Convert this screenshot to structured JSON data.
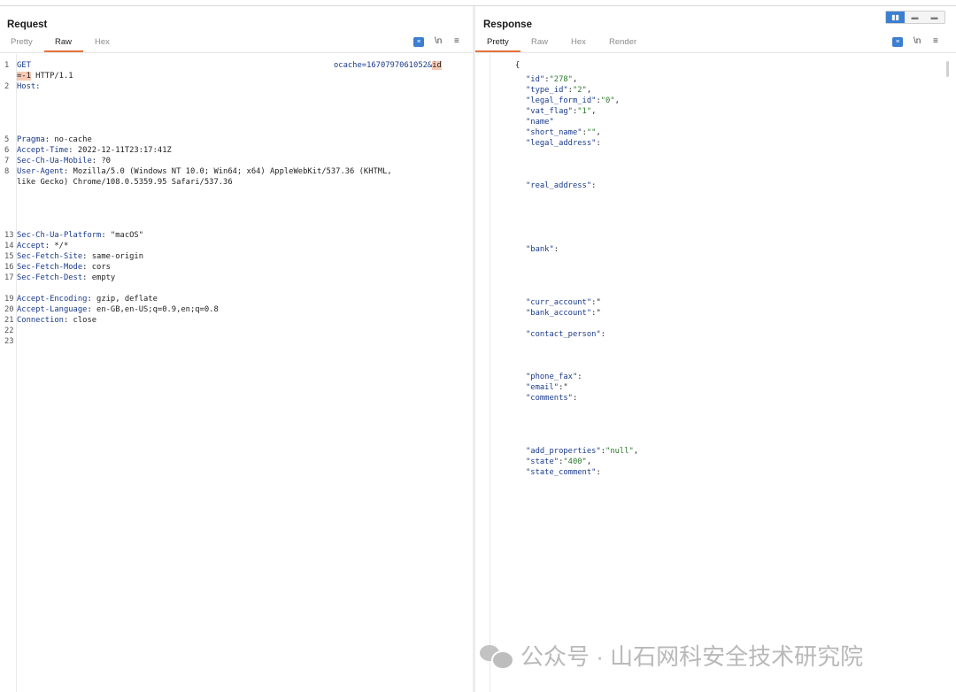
{
  "request": {
    "title": "Request",
    "tabs": [
      "Pretty",
      "Raw",
      "Hex"
    ],
    "active_tab": "Raw",
    "icons": {
      "actions": "list-icon",
      "newline": "\\n",
      "menu": "≡"
    },
    "lines": [
      {
        "n": "1",
        "parts": [
          {
            "t": "GET",
            "c": "hdr"
          }
        ]
      },
      {
        "n": "",
        "parts": [
          {
            "t": "=-1",
            "c": "hl"
          },
          {
            "t": " HTTP/1.1",
            "c": "val"
          }
        ]
      },
      {
        "n": "2",
        "parts": [
          {
            "t": "Host:",
            "c": "hdr"
          }
        ]
      },
      {
        "n": "5",
        "parts": [
          {
            "t": "Pragma",
            "c": "hdr"
          },
          {
            "t": ": no-cache",
            "c": "val"
          }
        ]
      },
      {
        "n": "6",
        "parts": [
          {
            "t": "Accept-Time",
            "c": "hdr"
          },
          {
            "t": ": 2022-12-11T23:17:41Z",
            "c": "val"
          }
        ]
      },
      {
        "n": "7",
        "parts": [
          {
            "t": "Sec-Ch-Ua-Mobile",
            "c": "hdr"
          },
          {
            "t": ": ?0",
            "c": "val"
          }
        ]
      },
      {
        "n": "8",
        "parts": [
          {
            "t": "User-Agent",
            "c": "hdr"
          },
          {
            "t": ": Mozilla/5.0 (Windows NT 10.0; Win64; x64) AppleWebKit/537.36 (KHTML,",
            "c": "val"
          }
        ]
      },
      {
        "n": "",
        "parts": [
          {
            "t": "like Gecko) Chrome/108.0.5359.95 Safari/537.36",
            "c": "val"
          }
        ]
      },
      {
        "n": "13",
        "parts": [
          {
            "t": "Sec-Ch-Ua-Platform",
            "c": "hdr"
          },
          {
            "t": ": \"macOS\"",
            "c": "val"
          }
        ]
      },
      {
        "n": "14",
        "parts": [
          {
            "t": "Accept",
            "c": "hdr"
          },
          {
            "t": ": */*",
            "c": "val"
          }
        ]
      },
      {
        "n": "15",
        "parts": [
          {
            "t": "Sec-Fetch-Site",
            "c": "hdr"
          },
          {
            "t": ": same-origin",
            "c": "val"
          }
        ]
      },
      {
        "n": "16",
        "parts": [
          {
            "t": "Sec-Fetch-Mode",
            "c": "hdr"
          },
          {
            "t": ": cors",
            "c": "val"
          }
        ]
      },
      {
        "n": "17",
        "parts": [
          {
            "t": "Sec-Fetch-Dest",
            "c": "hdr"
          },
          {
            "t": ": empty",
            "c": "val"
          }
        ]
      },
      {
        "n": "19",
        "parts": [
          {
            "t": "Accept-Encoding",
            "c": "hdr"
          },
          {
            "t": ": gzip, deflate",
            "c": "val"
          }
        ]
      },
      {
        "n": "20",
        "parts": [
          {
            "t": "Accept-Language",
            "c": "hdr"
          },
          {
            "t": ": en-GB,en-US;q=0.9,en;q=0.8",
            "c": "val"
          }
        ]
      },
      {
        "n": "21",
        "parts": [
          {
            "t": "Connection",
            "c": "hdr"
          },
          {
            "t": ": close",
            "c": "val"
          }
        ]
      },
      {
        "n": "22",
        "parts": []
      },
      {
        "n": "23",
        "parts": []
      }
    ],
    "url_fragment": [
      {
        "t": "ocache=1670797061052&",
        "c": "hdr"
      },
      {
        "t": "id",
        "c": "hl"
      }
    ]
  },
  "response": {
    "title": "Response",
    "tabs": [
      "Pretty",
      "Raw",
      "Hex",
      "Render"
    ],
    "active_tab": "Pretty",
    "icons": {
      "actions": "list-icon",
      "newline": "\\n",
      "menu": "≡"
    },
    "view_toggle": [
      "▮▮",
      "▬",
      "▬"
    ],
    "lines": [
      {
        "parts": [
          {
            "t": "{",
            "c": "val"
          }
        ]
      },
      {
        "parts": [
          {
            "t": "\"id\"",
            "c": "key"
          },
          {
            "t": ":",
            "c": "val"
          },
          {
            "t": "\"278\"",
            "c": "str"
          },
          {
            "t": ",",
            "c": "val"
          }
        ]
      },
      {
        "parts": [
          {
            "t": "\"type_id\"",
            "c": "key"
          },
          {
            "t": ":",
            "c": "val"
          },
          {
            "t": "\"2\"",
            "c": "str"
          },
          {
            "t": ",",
            "c": "val"
          }
        ]
      },
      {
        "parts": [
          {
            "t": "\"legal_form_id\"",
            "c": "key"
          },
          {
            "t": ":",
            "c": "val"
          },
          {
            "t": "\"0\"",
            "c": "str"
          },
          {
            "t": ",",
            "c": "val"
          }
        ]
      },
      {
        "parts": [
          {
            "t": "\"vat_flag\"",
            "c": "key"
          },
          {
            "t": ":",
            "c": "val"
          },
          {
            "t": "\"1\"",
            "c": "str"
          },
          {
            "t": ",",
            "c": "val"
          }
        ]
      },
      {
        "parts": [
          {
            "t": "\"name\"",
            "c": "key"
          }
        ]
      },
      {
        "parts": [
          {
            "t": "\"short_name\"",
            "c": "key"
          },
          {
            "t": ":",
            "c": "val"
          },
          {
            "t": "\"\"",
            "c": "str"
          },
          {
            "t": ",",
            "c": "val"
          }
        ]
      },
      {
        "parts": [
          {
            "t": "\"legal_address\"",
            "c": "key"
          },
          {
            "t": ":",
            "c": "val"
          }
        ]
      },
      {
        "parts": [
          {
            "t": "\"real_address\"",
            "c": "key"
          },
          {
            "t": ":",
            "c": "val"
          }
        ]
      },
      {
        "parts": [
          {
            "t": "\"bank\"",
            "c": "key"
          },
          {
            "t": ":",
            "c": "val"
          }
        ]
      },
      {
        "parts": [
          {
            "t": "\"curr_account\"",
            "c": "key"
          },
          {
            "t": ":\"",
            "c": "val"
          }
        ]
      },
      {
        "parts": [
          {
            "t": "\"bank_account\"",
            "c": "key"
          },
          {
            "t": ":\"",
            "c": "val"
          }
        ]
      },
      {
        "parts": [
          {
            "t": "\"contact_person\"",
            "c": "key"
          },
          {
            "t": ":",
            "c": "val"
          }
        ]
      },
      {
        "parts": [
          {
            "t": "\"phone_fax\"",
            "c": "key"
          },
          {
            "t": ":",
            "c": "val"
          }
        ]
      },
      {
        "parts": [
          {
            "t": "\"email\"",
            "c": "key"
          },
          {
            "t": ":\"",
            "c": "val"
          }
        ]
      },
      {
        "parts": [
          {
            "t": "\"comments\"",
            "c": "key"
          },
          {
            "t": ":",
            "c": "val"
          }
        ]
      },
      {
        "parts": [
          {
            "t": "\"add_properties\"",
            "c": "key"
          },
          {
            "t": ":",
            "c": "val"
          },
          {
            "t": "\"null\"",
            "c": "str"
          },
          {
            "t": ",",
            "c": "val"
          }
        ]
      },
      {
        "parts": [
          {
            "t": "\"state\"",
            "c": "key"
          },
          {
            "t": ":",
            "c": "val"
          },
          {
            "t": "\"400\"",
            "c": "str"
          },
          {
            "t": ",",
            "c": "val"
          }
        ]
      },
      {
        "parts": [
          {
            "t": "\"state_comment\"",
            "c": "key"
          },
          {
            "t": ":",
            "c": "val"
          }
        ]
      }
    ]
  },
  "watermark": {
    "text": "公众号 · 山石网科安全技术研究院",
    "logo": "wechat-logo"
  },
  "colors": {
    "accent": "#e8733a",
    "blue": "#3c7fd0",
    "header_key": "#1a3a8a",
    "string": "#2a7a2a",
    "highlight": "#f7c9b3"
  }
}
